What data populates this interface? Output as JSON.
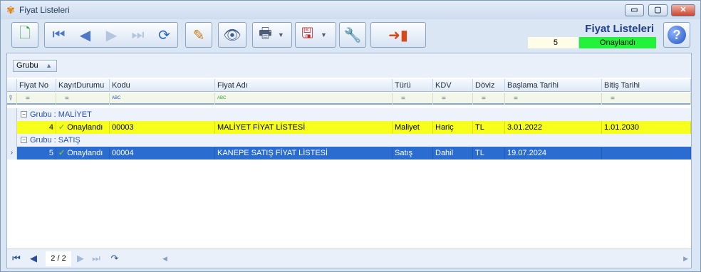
{
  "window": {
    "title": "Fiyat Listeleri",
    "controls": {
      "minimize": "▭",
      "maximize": "▢",
      "close": "✕"
    }
  },
  "toolbar": {
    "page_title": "Fiyat Listeleri",
    "record_count": "5",
    "status": "Onaylandı"
  },
  "groupbar": {
    "group_chip": "Grubu"
  },
  "columns": [
    "Fiyat No",
    "KayıtDurumu",
    "Kodu",
    "Fiyat Adı",
    "Türü",
    "KDV",
    "Döviz",
    "Başlama Tarihi",
    "Bitiş Tarihi"
  ],
  "filter_symbols": [
    "=",
    "=",
    "ABC",
    "ABC",
    "=",
    "=",
    "=",
    "=",
    "="
  ],
  "groups": [
    {
      "label": "Grubu : MALİYET",
      "rows": [
        {
          "fiyat_no": "4",
          "kayit_durumu": "Onaylandı",
          "kodu": "00003",
          "fiyat_adi": "MALİYET FİYAT LİSTESİ",
          "turu": "Maliyet",
          "kdv": "Hariç",
          "doviz": "TL",
          "baslama": "3.01.2022",
          "bitis": "1.01.2030"
        }
      ]
    },
    {
      "label": "Grubu : SATIŞ",
      "rows": [
        {
          "fiyat_no": "5",
          "kayit_durumu": "Onaylandı",
          "kodu": "00004",
          "fiyat_adi": "KANEPE SATIŞ FİYAT LİSTESİ",
          "turu": "Satış",
          "kdv": "Dahil",
          "doviz": "TL",
          "baslama": "19.07.2024",
          "bitis": ""
        }
      ]
    }
  ],
  "navigator": {
    "page": "2 / 2"
  },
  "colors": {
    "highlight_row": "#f7ff1d",
    "selected_row": "#2a6ccf",
    "status_green": "#22f23a",
    "title_blue": "#1e3d8f"
  }
}
